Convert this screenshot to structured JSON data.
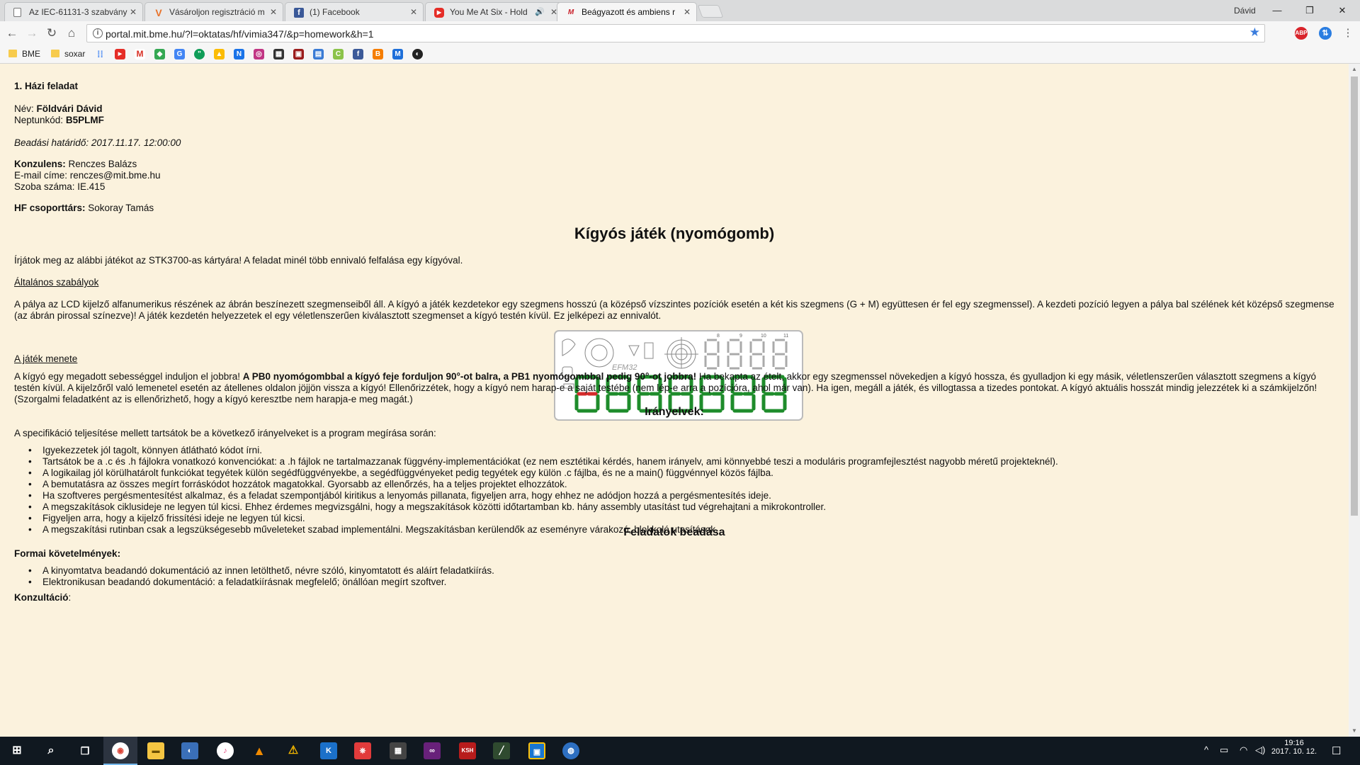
{
  "browser": {
    "tabs": [
      {
        "title": "Az IEC-61131-3 szabvány",
        "icon": "document-icon"
      },
      {
        "title": "Vásároljon regisztráció m",
        "icon": "v-icon"
      },
      {
        "title": "(1) Facebook",
        "icon": "facebook-icon"
      },
      {
        "title": "You Me At Six - Hold",
        "icon": "youtube-icon"
      },
      {
        "title": "Beágyazott és ambiens r",
        "icon": "mit-icon"
      }
    ],
    "profile_name": "Dávid",
    "url": "portal.mit.bme.hu/?l=oktatas/hf/vimia347/&p=homework&h=1",
    "bookmarks": [
      "BME",
      "soxar"
    ],
    "extensions": [
      "ABP"
    ]
  },
  "page": {
    "hw_title": "1. Házi feladat",
    "name_label": "Név:",
    "name_value": "Földvári Dávid",
    "neptun_label": "Neptunkód:",
    "neptun_value": "B5PLMF",
    "deadline": "Beadási határidő: 2017.11.17. 12:00:00",
    "consultant_label": "Konzulens:",
    "consultant_value": "Renczes Balázs",
    "email": "E-mail címe: renczes@mit.bme.hu",
    "room": "Szoba száma: IE.415",
    "partner_label": "HF csoporttárs:",
    "partner_value": "Sokoray Tamás",
    "main_title": "Kígyós játék (nyomógomb)",
    "intro": "Írjátok meg az alábbi játékot az STK3700-as kártyára! A feladat minél több ennivaló felfalása egy kígyóval.",
    "general_rules_heading": "Általános szabályok",
    "general_rules_text": "A pálya az LCD kijelző alfanumerikus részének az ábrán beszínezett szegmenseiből áll. A kígyó a játék kezdetekor egy szegmens hosszú (a középső vízszintes pozíciók esetén a két kis szegmens (G + M) együttesen ér fel egy szegmenssel). A kezdeti pozíció legyen a pálya bal szélének két középső szegmense (az ábrán pirossal színezve)! A játék kezdetén helyezzetek el egy véletlenszerűen kiválasztott szegmenset a kígyó testén kívül. Ez jelképezi az ennivalót.",
    "gameplay_heading": "A játék menete",
    "gameplay_text_1": "A kígyó egy megadott sebességgel induljon el jobbra! ",
    "gameplay_text_bold": "A PB0 nyomógombbal a kígyó feje forduljon 90°-ot balra, a PB1 nyomógombbal pedig 90°-ot jobbra!",
    "gameplay_text_2": " Ha bekapta az ételt, akkor egy szegmenssel növekedjen a kígyó hossza, és gyulladjon ki egy másik, véletlenszerűen választott szegmens a kígyó testén kívül. A kijelzőről való lemenetel esetén az átellenes oldalon jöjjön vissza a kígyó! Ellenőrizzétek, hogy a kígyó nem harap-e a saját testébe (nem lép-e arra a pozícióra, ahol már van). Ha igen, megáll a játék, és villogtassa a tizedes pontokat. A kígyó aktuális hosszát mindig jelezzétek ki a számkijelzőn! (Szorgalmi feladatként az is ellenőrizhető, hogy a kígyó keresztbe nem harapja-e meg magát.)",
    "guidelines_heading": "Irányelvek:",
    "guidelines_intro": "A specifikáció teljesítése mellett tartsátok be a következő irányelveket is a program megírása során:",
    "guidelines": [
      "Igyekezzetek jól tagolt, könnyen átlátható kódot írni.",
      "Tartsátok be a .c és .h fájlokra vonatkozó konvenciókat: a .h fájlok ne tartalmazzanak függvény-implementációkat (ez nem esztétikai kérdés, hanem irányelv, ami könnyebbé teszi a moduláris programfejlesztést nagyobb méretű projekteknél).",
      "A logikailag jól körülhatárolt funkciókat tegyétek külön segédfüggvényekbe, a segédfüggvényeket pedig tegyétek egy külön .c fájlba, és ne a main() függvénnyel közös fájlba.",
      "A bemutatásra az összes megírt forráskódot hozzátok magatokkal. Gyorsabb az ellenőrzés, ha a teljes projektet elhozzátok.",
      "Ha szoftveres pergésmentesítést alkalmaz, és a feladat szempontjából kiritikus a lenyomás pillanata, figyeljen arra, hogy ehhez ne adódjon hozzá a pergésmentesítés ideje.",
      "A megszakítások ciklusideje ne legyen túl kicsi. Ehhez érdemes megvizsgálni, hogy a megszakítások közötti időtartamban kb. hány assembly utasítást tud végrehajtani a mikrokontroller.",
      "Figyeljen arra, hogy a kijelző frissítési ideje ne legyen túl kicsi.",
      "A megszakítási rutinban csak a legszükségesebb műveleteket szabad implementálni. Megszakításban kerülendők az eseményre várakozó, blokkoló utasítások."
    ],
    "submission_heading": "Feladatok beadása",
    "formal_heading": "Formai követelmények:",
    "formal_items": [
      "A kinyomtatva beadandó dokumentáció az innen letölthető, névre szóló, kinyomtatott és aláírt feladatkiírás.",
      "Elektronikusan beadandó dokumentáció: a feladatkiírásnak megfelelő; önállóan megírt szoftver."
    ],
    "consultation_heading": "Konzultáció",
    "lcd_label": "EFM32",
    "lcd_digit_numbers": [
      "8",
      "9",
      "10",
      "11"
    ],
    "lcd_colors": {
      "segment": "#1e8c2b",
      "start_segment": "#d42b2b"
    }
  },
  "taskbar": {
    "time": "19:16",
    "date": "2017. 10. 12."
  }
}
